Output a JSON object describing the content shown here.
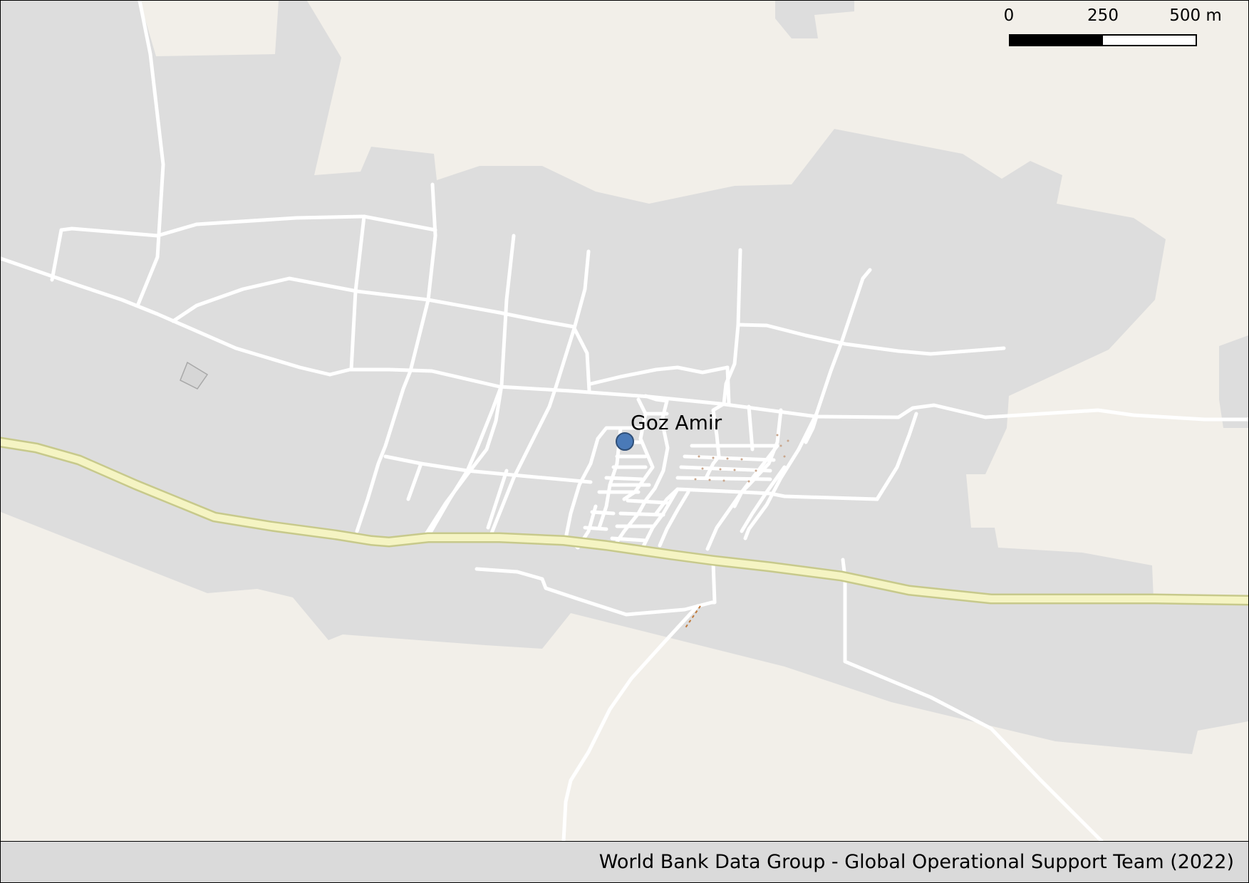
{
  "map": {
    "place_name": "Goz Amir",
    "scale_bar": {
      "labels": [
        "0",
        "250",
        "500 m"
      ]
    },
    "credit": "World Bank Data Group - Global Operational Support Team (2022)",
    "colors": {
      "background": "#f2efe9",
      "landuse": "#dddddd",
      "road": "#ffffff",
      "primary_road": "#f5f4c3",
      "primary_road_casing": "#c7c98b",
      "place_marker": "#4a7ab8",
      "footer": "#dadada"
    }
  }
}
